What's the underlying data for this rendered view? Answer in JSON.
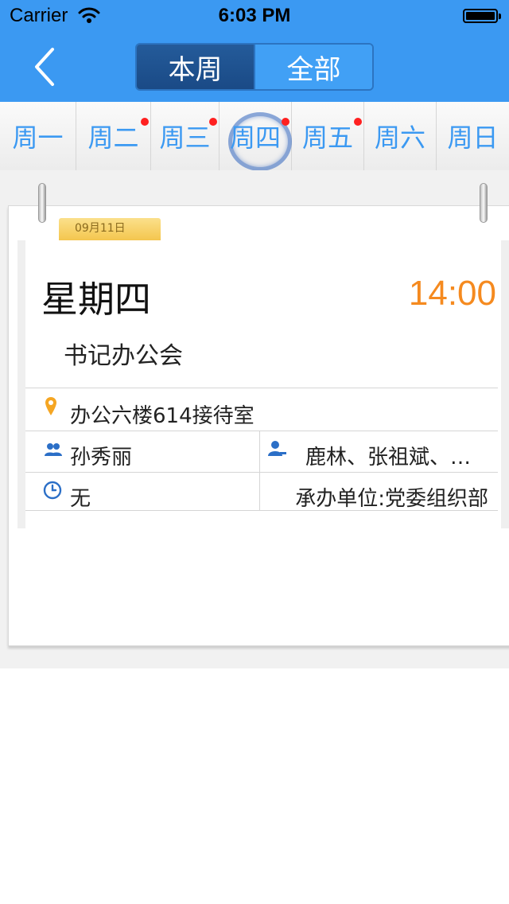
{
  "status_bar": {
    "carrier": "Carrier",
    "time": "6:03 PM"
  },
  "nav": {
    "segments": [
      {
        "label": "本周",
        "active": true
      },
      {
        "label": "全部",
        "active": false
      }
    ]
  },
  "week": {
    "days": [
      {
        "label": "周一",
        "has_event": false,
        "selected": false
      },
      {
        "label": "周二",
        "has_event": true,
        "selected": false
      },
      {
        "label": "周三",
        "has_event": true,
        "selected": false
      },
      {
        "label": "周四",
        "has_event": true,
        "selected": true
      },
      {
        "label": "周五",
        "has_event": true,
        "selected": false
      },
      {
        "label": "周六",
        "has_event": false,
        "selected": false
      },
      {
        "label": "周日",
        "has_event": false,
        "selected": false
      }
    ]
  },
  "date_tab": "09月11日",
  "event": {
    "weekday": "星期四",
    "time": "14:00",
    "title": "书记办公会",
    "location": "办公六楼614接待室",
    "host": "孙秀丽",
    "participants": "鹿林、张祖斌、…",
    "reminder": "无",
    "organizer": "承办单位:党委组织部"
  },
  "colors": {
    "header_blue": "#3b99f2",
    "accent_orange": "#f58a1f",
    "event_dot_red": "#ff2020",
    "icon_blue": "#2b6fc7"
  },
  "icons": [
    "wifi-icon",
    "battery-icon",
    "back-chevron-icon",
    "location-pin-icon",
    "group-icon",
    "person-icon",
    "clock-icon"
  ]
}
